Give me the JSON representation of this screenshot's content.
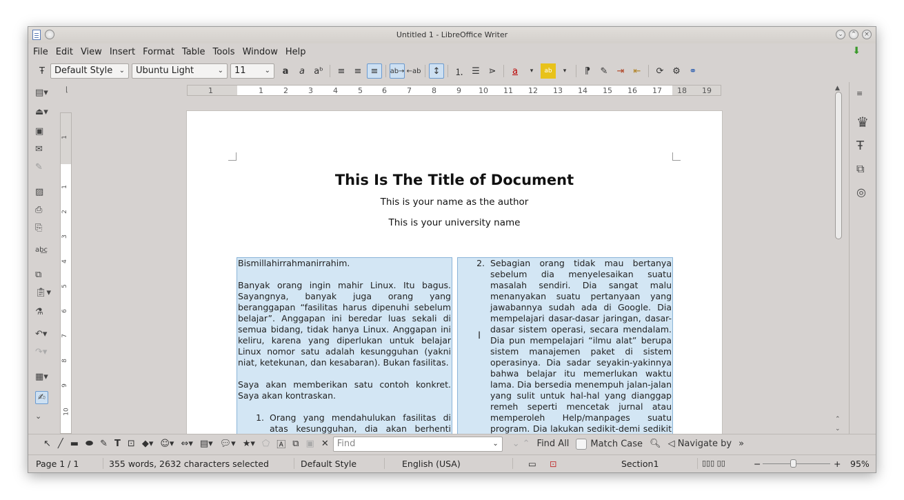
{
  "window": {
    "title": "Untitled 1 - LibreOffice Writer"
  },
  "menu": [
    "File",
    "Edit",
    "View",
    "Insert",
    "Format",
    "Table",
    "Tools",
    "Window",
    "Help"
  ],
  "toolbar": {
    "paragraph_style": "Default Style",
    "font_name": "Ubuntu Light",
    "font_size": "11"
  },
  "ruler": {
    "h_ticks": [
      "1",
      "1",
      "2",
      "3",
      "4",
      "5",
      "6",
      "7",
      "8",
      "9",
      "10",
      "11",
      "12",
      "13",
      "14",
      "15",
      "16",
      "17",
      "18",
      "19"
    ],
    "v_ticks": [
      "1",
      "1",
      "2",
      "3",
      "4",
      "5",
      "6",
      "7",
      "8",
      "9",
      "10"
    ]
  },
  "document": {
    "title": "This Is The Title of Document",
    "author": "This is your name as the author",
    "university": "This is your university name",
    "col1": {
      "p1": "Bismillahirrahmanirrahim.",
      "p2": "Banyak orang ingin mahir Linux. Itu bagus. Sayangnya, banyak juga orang yang beranggapan “fasilitas harus dipenuhi sebelum belajar”. Anggapan ini beredar luas sekali di semua bidang, tidak hanya Linux. Anggapan ini keliru, karena yang diperlukan untuk belajar Linux nomor satu adalah kesungguhan (yakni niat, ketekunan, dan kesabaran). Bukan fasilitas.",
      "p3": "Saya akan memberikan satu contoh konkret. Saya akan kontraskan.",
      "item1_num": "1.",
      "item1": "Orang yang mendahulukan fasilitas di atas kesungguhan, dia akan berhenti belajar"
    },
    "col2": {
      "item2_num": "2.",
      "item2": "Sebagian orang tidak mau bertanya sebelum dia menyelesaikan suatu masalah sendiri. Dia sangat malu menanyakan suatu pertanyaan yang jawabannya sudah ada di Google. Dia mempelajari dasar-dasar jaringan, dasar-dasar sistem operasi, secara mendalam. Dia pun mempelajari “ilmu alat” berupa sistem manajemen paket di sistem operasinya. Dia sadar seyakin-yakinnya bahwa belajar itu memerlukan waktu lama. Dia bersedia menempuh jalan-jalan yang sulit untuk hal-hal yang dianggap remeh seperti mencetak jurnal atau memperoleh Help/manpages suatu program. Dia lakukan sedikit-demi sedikit ketika tidak punya uang, dan proporsional"
    }
  },
  "findbar": {
    "placeholder": "Find",
    "find_all": "Find All",
    "match_case": "Match Case",
    "navigate_by": "Navigate by"
  },
  "status": {
    "page": "Page 1 / 1",
    "words": "355 words, 2632 characters selected",
    "style": "Default Style",
    "language": "English (USA)",
    "section": "Section1",
    "zoom": "95%"
  }
}
